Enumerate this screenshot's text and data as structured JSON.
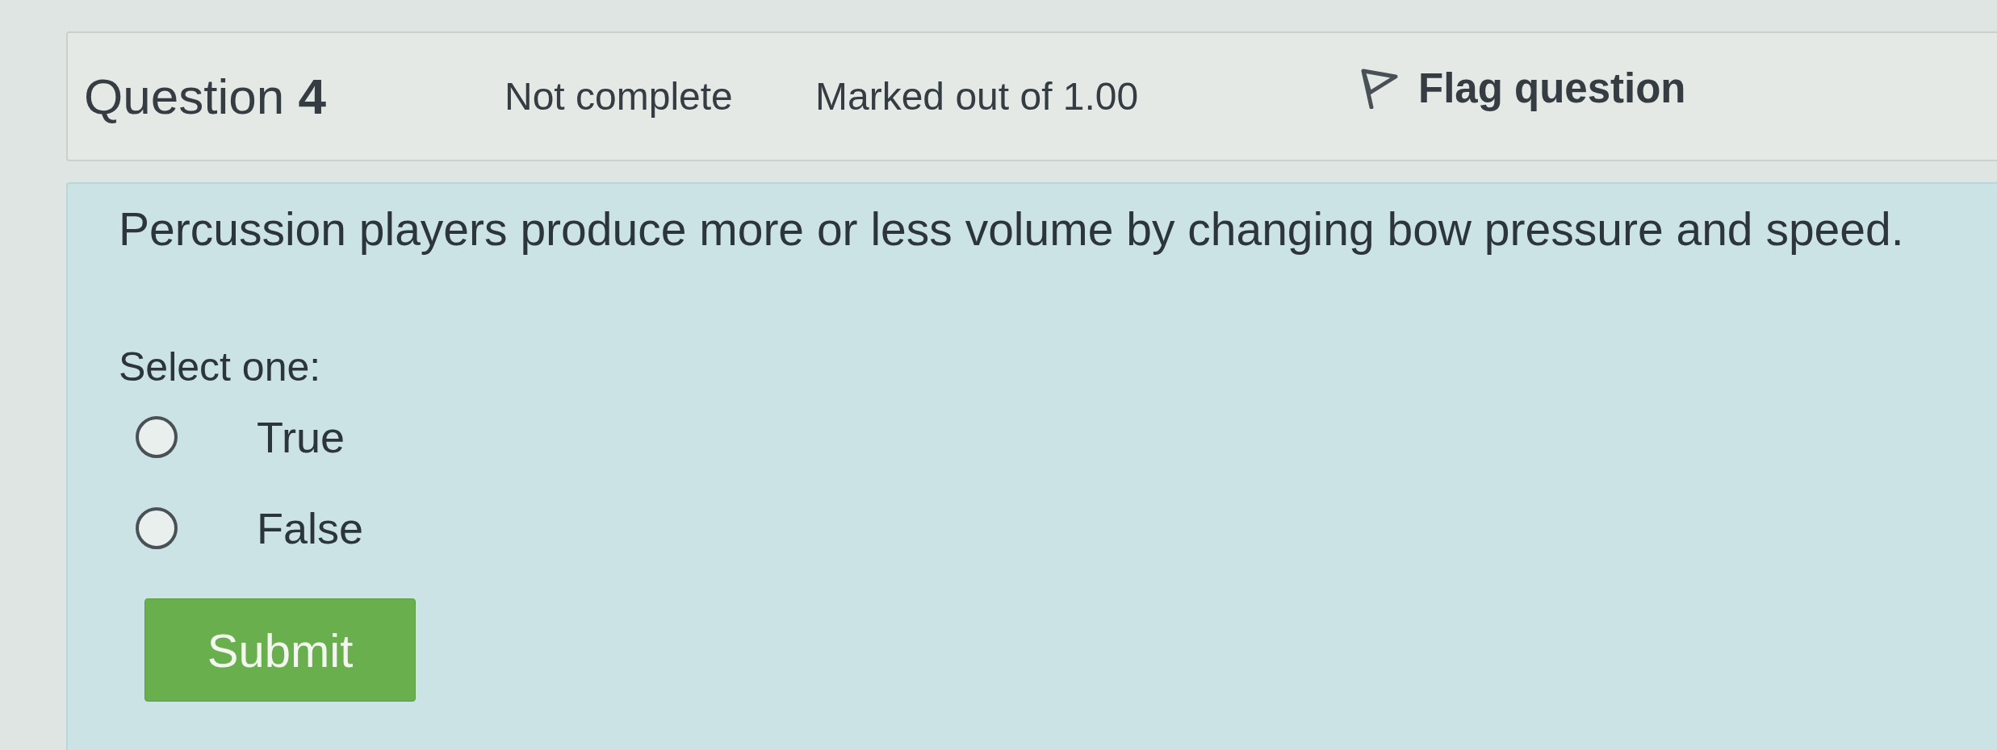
{
  "question": {
    "title": "Question **4**",
    "status": "Not complete",
    "marks": "Marked out of 1.00",
    "flag": {
      "label": "Flag question",
      "flagged": false
    }
  },
  "prompt": "Percussion players produce more or less volume by changing bow pressure and speed.",
  "answer": {
    "instruction": "Select one:",
    "options": [
      {
        "label": "True",
        "selected": false
      },
      {
        "label": "False",
        "selected": false
      }
    ]
  },
  "submit": {
    "label": "Submit"
  }
}
